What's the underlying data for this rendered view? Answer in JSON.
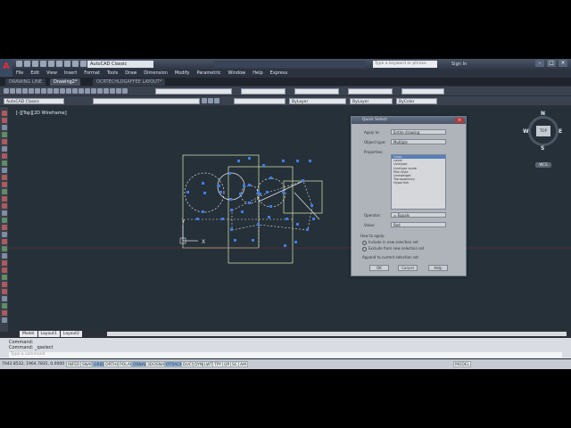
{
  "app": {
    "workspace": "AutoCAD Classic",
    "search_placeholder": "Type a keyword or phrase",
    "signin": "Sign In",
    "window_buttons": [
      "–",
      "□",
      "×"
    ]
  },
  "menu": [
    "File",
    "Edit",
    "View",
    "Insert",
    "Format",
    "Tools",
    "Draw",
    "Dimension",
    "Modify",
    "Parametric",
    "Window",
    "Help",
    "Express"
  ],
  "tabs": [
    "DRAWING LINE",
    "Drawing2*",
    "OCRTECHLOGAFFEE LAYOUT*"
  ],
  "toolbar": {
    "workspace_combo": "AutoCAD Classic",
    "bylayer1": "ByLayer",
    "bylayer2": "ByLayer",
    "bycolor": "ByColor"
  },
  "viewport": {
    "label": "[-][Top][2D Wireframe]"
  },
  "viewcube": {
    "face": "TOP",
    "north": "N",
    "south": "S",
    "east": "E",
    "west": "W",
    "wcs": "WCS"
  },
  "layout_tabs": [
    "Model",
    "Layout1",
    "Layout2"
  ],
  "command": {
    "line1": "Command:",
    "line2": "Command: _qselect",
    "input_placeholder": "Type a command"
  },
  "status": {
    "coords": "7042.8532, 1964.7835, 0.0000",
    "buttons": [
      "INFER",
      "SNAP",
      "GRID",
      "ORTHO",
      "POLAR",
      "OSNAP",
      "3DOSNAP",
      "OTRACK",
      "DUCS",
      "DYN",
      "LWT",
      "TPY",
      "QP",
      "SC",
      "AM"
    ],
    "on_buttons": [
      "GRID",
      "OSNAP",
      "OTRACK"
    ],
    "model": "MODEL"
  },
  "dialog": {
    "title": "Quick Select",
    "apply_to_label": "Apply to:",
    "apply_to": "Entire drawing",
    "object_type_label": "Object type:",
    "object_type": "Multiple",
    "properties_label": "Properties:",
    "properties": [
      "Color",
      "Layer",
      "Linetype",
      "Linetype scale",
      "Plot style",
      "Lineweight",
      "Transparency",
      "Hyperlink"
    ],
    "operator_label": "Operator:",
    "operator": "= Equals",
    "value_label": "Value:",
    "value": "Red",
    "how_label": "How to apply:",
    "radio1": "Include in new selection set",
    "radio2": "Exclude from new selection set",
    "check1": "Append to current selection set",
    "ok": "OK",
    "cancel": "Cancel",
    "help": "Help"
  }
}
